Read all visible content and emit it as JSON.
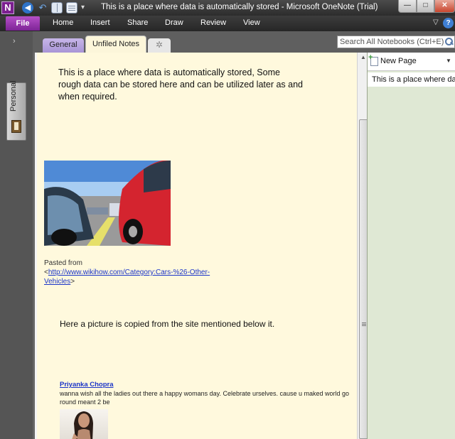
{
  "window": {
    "title": "This is a place where data is automatically stored  -  Microsoft OneNote (Trial)",
    "app_logo": "N",
    "min_glyph": "—",
    "max_glyph": "□",
    "close_glyph": "✕"
  },
  "ribbon": {
    "file": "File",
    "tabs": [
      "Home",
      "Insert",
      "Share",
      "Draw",
      "Review",
      "View"
    ],
    "help": "?",
    "collapse_glyph": "▽"
  },
  "notebook": {
    "name": "Personal",
    "expand_glyph": "›"
  },
  "sections": {
    "tabs": [
      "General",
      "Unfiled Notes"
    ],
    "new_tab_glyph": "✲",
    "search_placeholder": "Search All Notebooks (Ctrl+E)"
  },
  "page": {
    "intro": "This is a place where data is automatically stored, Some rough data can be stored here and can be utilized later as and when required.",
    "pasted_from_label": "Pasted from",
    "pasted_from_open": "<",
    "pasted_from_link": "http://www.wikihow.com/Category:Cars-%26-Other-Vehicles",
    "pasted_from_close": ">",
    "picture_note": "Here a picture is copied from the site mentioned below it.",
    "author": "Priyanka Chopra",
    "post": "wanna wish all the ladies out there a happy womans day. Celebrate urselves. cause u maked world go round meant 2 be"
  },
  "page_list": {
    "new_page": "New Page",
    "pages": [
      "This is a place where data is automatically stored"
    ]
  },
  "colors": {
    "file_tab": "#9a37b1",
    "page_bg": "#fff9dd",
    "page_list_bg": "#dfe8d4",
    "link": "#1a34c8"
  }
}
